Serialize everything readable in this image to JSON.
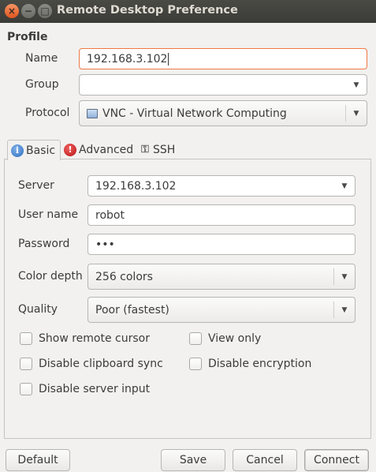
{
  "window": {
    "title": "Remote Desktop Preference"
  },
  "profile": {
    "section_title": "Profile",
    "name_label": "Name",
    "name_value": "192.168.3.102",
    "group_label": "Group",
    "group_value": "",
    "protocol_label": "Protocol",
    "protocol_value": "VNC - Virtual Network Computing"
  },
  "tabs": [
    {
      "label": "Basic",
      "icon": "info-icon",
      "active": true
    },
    {
      "label": "Advanced",
      "icon": "warning-icon",
      "active": false
    },
    {
      "label": "SSH",
      "icon": "key-icon",
      "active": false
    }
  ],
  "basic": {
    "server_label": "Server",
    "server_value": "192.168.3.102",
    "username_label": "User name",
    "username_value": "robot",
    "password_label": "Password",
    "password_value": "•••",
    "colordepth_label": "Color depth",
    "colordepth_value": "256 colors",
    "quality_label": "Quality",
    "quality_value": "Poor (fastest)",
    "checkboxes": [
      {
        "label": "Show remote cursor",
        "checked": false
      },
      {
        "label": "View only",
        "checked": false
      },
      {
        "label": "Disable clipboard sync",
        "checked": false
      },
      {
        "label": "Disable encryption",
        "checked": false
      },
      {
        "label": "Disable server input",
        "checked": false
      }
    ]
  },
  "buttons": {
    "default": "Default",
    "save": "Save",
    "cancel": "Cancel",
    "connect": "Connect"
  },
  "colors": {
    "focus_border": "#f07746",
    "titlebar": "#3c3b37",
    "close_button": "#e95420"
  }
}
